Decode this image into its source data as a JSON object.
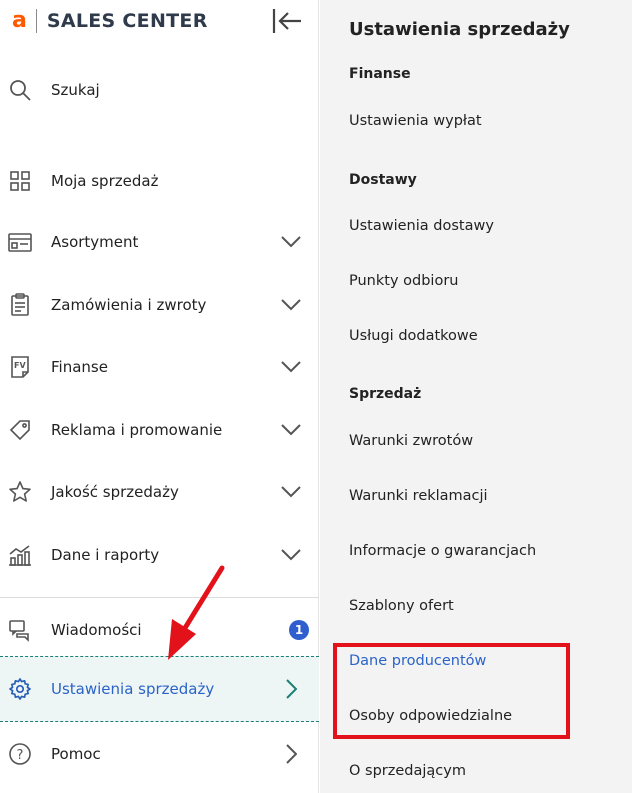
{
  "brand": {
    "logo": "a",
    "name": "SALES CENTER"
  },
  "sidebar": {
    "items": [
      {
        "label": "Szukaj"
      },
      {
        "label": "Moja sprzedaż"
      },
      {
        "label": "Asortyment"
      },
      {
        "label": "Zamówienia i zwroty"
      },
      {
        "label": "Finanse"
      },
      {
        "label": "Reklama i promowanie"
      },
      {
        "label": "Jakość sprzedaży"
      },
      {
        "label": "Dane i raporty"
      },
      {
        "label": "Wiadomości",
        "badge": "1"
      },
      {
        "label": "Ustawienia sprzedaży"
      },
      {
        "label": "Pomoc"
      }
    ]
  },
  "submenu": {
    "title": "Ustawienia sprzedaży",
    "sections": [
      {
        "heading": "Finanse",
        "links": [
          "Ustawienia wypłat"
        ]
      },
      {
        "heading": "Dostawy",
        "links": [
          "Ustawienia dostawy",
          "Punkty odbioru",
          "Usługi dodatkowe"
        ]
      },
      {
        "heading": "Sprzedaż",
        "links": [
          "Warunki zwrotów",
          "Warunki reklamacji",
          "Informacje o gwarancjach",
          "Szablony ofert",
          "Dane producentów",
          "Osoby odpowiedzialne",
          "O sprzedającym"
        ]
      }
    ]
  },
  "colors": {
    "brand_orange": "#ff5a00",
    "active_teal": "#1a7f74",
    "link_blue": "#2a63c8",
    "badge_blue": "#2f5fcf",
    "annotation_red": "#e3111a"
  }
}
